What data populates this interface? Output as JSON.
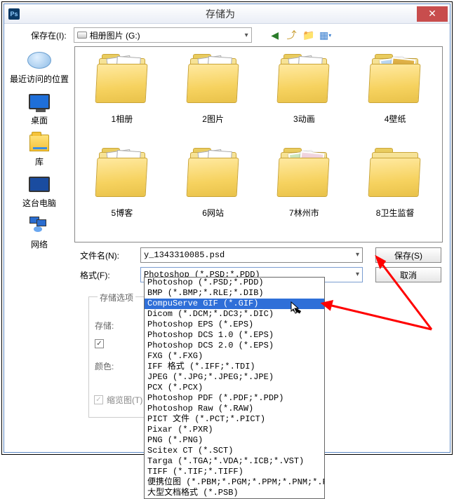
{
  "window": {
    "title": "存储为",
    "close": "✕"
  },
  "toolbar": {
    "save_in_label": "保存在(I):",
    "save_in_value": "相册图片 (G:)"
  },
  "places": {
    "recent": "最近访问的位置",
    "desktop": "桌面",
    "library": "库",
    "this_pc": "这台电脑",
    "network": "网络"
  },
  "folders": [
    {
      "label": "1相册",
      "thumbs": "pages"
    },
    {
      "label": "2图片",
      "thumbs": "pages"
    },
    {
      "label": "3动画",
      "thumbs": "pages"
    },
    {
      "label": "4壁纸",
      "thumbs": "photos-a"
    },
    {
      "label": "5博客",
      "thumbs": "pages"
    },
    {
      "label": "6网站",
      "thumbs": "pages"
    },
    {
      "label": "7林州市",
      "thumbs": "photos-b"
    },
    {
      "label": "8卫生监督",
      "thumbs": "plain"
    }
  ],
  "filename": {
    "label": "文件名(N):",
    "value": "y_1343310085.psd"
  },
  "format": {
    "label": "格式(F):",
    "selected": "Photoshop (*.PSD;*.PDD)",
    "options": [
      "Photoshop (*.PSD;*.PDD)",
      "BMP (*.BMP;*.RLE;*.DIB)",
      "CompuServe GIF (*.GIF)",
      "Dicom (*.DCM;*.DC3;*.DIC)",
      "Photoshop EPS (*.EPS)",
      "Photoshop DCS 1.0 (*.EPS)",
      "Photoshop DCS 2.0 (*.EPS)",
      "FXG (*.FXG)",
      "IFF 格式 (*.IFF;*.TDI)",
      "JPEG (*.JPG;*.JPEG;*.JPE)",
      "PCX (*.PCX)",
      "Photoshop PDF (*.PDF;*.PDP)",
      "Photoshop Raw (*.RAW)",
      "PICT 文件 (*.PCT;*.PICT)",
      "Pixar (*.PXR)",
      "PNG (*.PNG)",
      "Scitex CT (*.SCT)",
      "Targa (*.TGA;*.VDA;*.ICB;*.VST)",
      "TIFF (*.TIF;*.TIFF)",
      "便携位图 (*.PBM;*.PGM;*.PPM;*.PNM;*.PFM;*.PAM)",
      "大型文档格式 (*.PSB)"
    ],
    "highlighted_index": 2
  },
  "buttons": {
    "save": "保存(S)",
    "cancel": "取消"
  },
  "options_panel": {
    "legend": "存储选项",
    "store_label": "存储:",
    "color_label": "颜色:",
    "thumbnail": "缩览图(T)"
  }
}
